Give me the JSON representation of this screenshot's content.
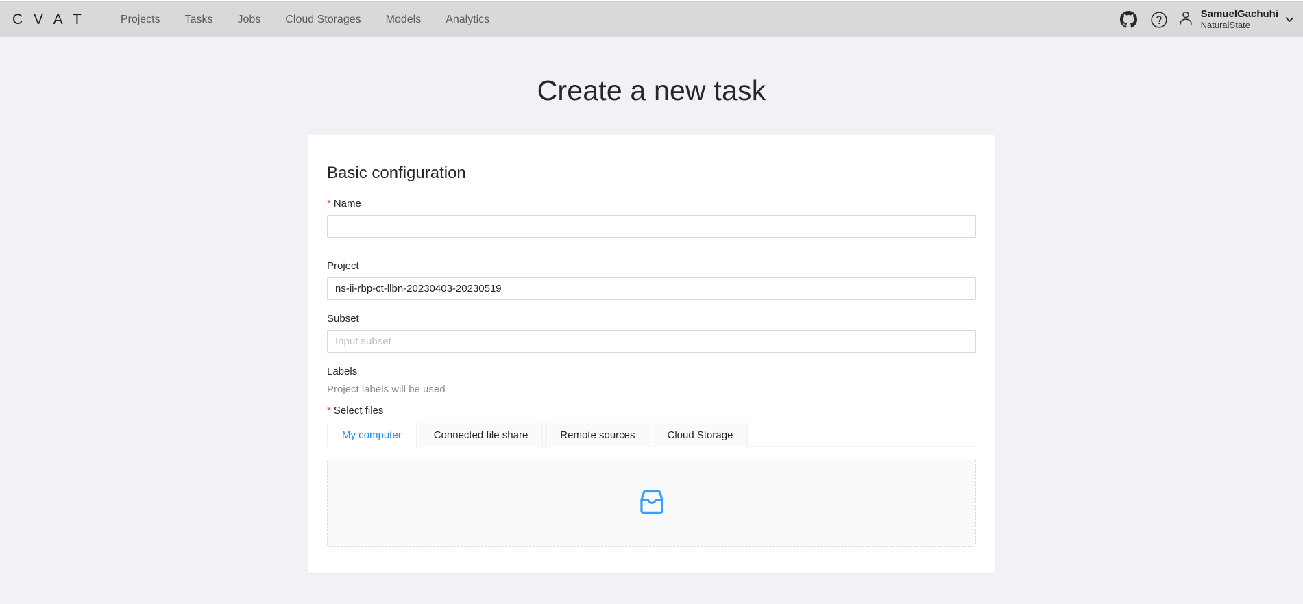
{
  "header": {
    "logo": "C V A T",
    "nav_items": [
      {
        "label": "Projects"
      },
      {
        "label": "Tasks"
      },
      {
        "label": "Jobs"
      },
      {
        "label": "Cloud Storages"
      },
      {
        "label": "Models"
      },
      {
        "label": "Analytics"
      }
    ],
    "github_icon": "github-icon",
    "help_icon": "question-circle-icon",
    "avatar_icon": "user-avatar-icon",
    "user_name": "SamuelGachuhi",
    "user_org": "NaturalState",
    "caret_icon": "chevron-down-icon"
  },
  "page": {
    "title": "Create a new task"
  },
  "form": {
    "section_title": "Basic configuration",
    "name": {
      "label": "Name",
      "required_marker": "*",
      "value": "",
      "placeholder": ""
    },
    "project": {
      "label": "Project",
      "value": "ns-ii-rbp-ct-llbn-20230403-20230519",
      "placeholder": ""
    },
    "subset": {
      "label": "Subset",
      "value": "",
      "placeholder": "Input subset"
    },
    "labels": {
      "label": "Labels",
      "hint": "Project labels will be used"
    },
    "select_files": {
      "label": "Select files",
      "required_marker": "*",
      "tabs": [
        {
          "label": "My computer",
          "active": true
        },
        {
          "label": "Connected file share",
          "active": false
        },
        {
          "label": "Remote sources",
          "active": false
        },
        {
          "label": "Cloud Storage",
          "active": false
        }
      ],
      "dropzone_icon": "inbox-icon"
    }
  },
  "colors": {
    "accent": "#1890ff",
    "header_bg": "#d9d9d9",
    "page_bg": "#f0f2f5",
    "card_bg": "#ffffff",
    "required_red": "#ff4d4f",
    "muted_text": "#8c8c8c",
    "border": "#d9d9d9"
  }
}
